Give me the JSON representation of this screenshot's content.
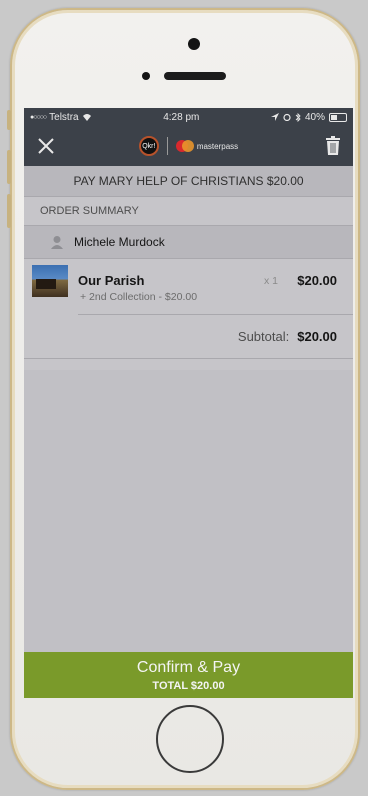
{
  "status_bar": {
    "carrier": "Telstra",
    "time": "4:28 pm",
    "battery": "40%",
    "battery_level": 0.4
  },
  "nav": {
    "brand_logo_text": "Qkr!",
    "payment_brand": "masterpass"
  },
  "pay_title": "PAY MARY HELP OF CHRISTIANS $20.00",
  "order_summary": {
    "header": "ORDER SUMMARY",
    "person": "Michele Murdock",
    "item": {
      "name": "Our Parish",
      "detail": "+ 2nd Collection - $20.00",
      "quantity": "x 1",
      "price": "$20.00"
    },
    "subtotal_label": "Subtotal:",
    "subtotal_value": "$20.00"
  },
  "confirm": {
    "label": "Confirm & Pay",
    "total": "TOTAL $20.00"
  },
  "colors": {
    "nav_bg": "#3c4149",
    "confirm_bg": "#7a9a2a",
    "mastercard_red": "#d9282d",
    "mastercard_orange": "#e8952b"
  }
}
